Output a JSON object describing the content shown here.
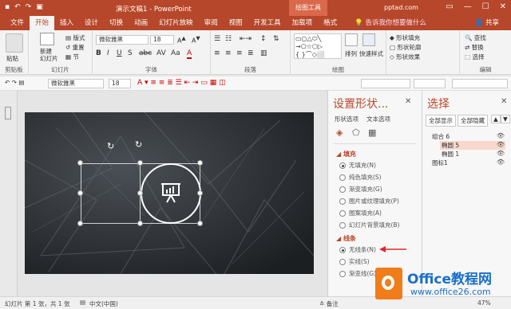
{
  "titlebar": {
    "title": "演示文稿1 - PowerPoint",
    "tool_context": "绘图工具",
    "user": "pptad.com"
  },
  "tabs": {
    "file": "文件",
    "home": "开始",
    "insert": "插入",
    "design": "设计",
    "transitions": "切换",
    "animations": "动画",
    "slideshow": "幻灯片放映",
    "review": "审阅",
    "view": "视图",
    "developer": "开发工具",
    "addins": "加载项",
    "format": "格式",
    "tellme": "告诉我你想要做什么",
    "share": "共享"
  },
  "ribbon": {
    "paste": "粘贴",
    "new_slide": "新建\n幻灯片",
    "layout": "版式",
    "reset": "重置",
    "section": "节",
    "font_name": "微软雅黑",
    "font_size": "18",
    "arrange": "排列",
    "quick_styles": "快速样式",
    "shape_fill": "形状填充",
    "shape_outline": "形状轮廓",
    "shape_effects": "形状效果",
    "find": "查找",
    "replace": "替换",
    "select": "选择",
    "groups": {
      "clipboard": "剪贴板",
      "slides": "幻灯片",
      "font": "字体",
      "paragraph": "段落",
      "drawing": "绘图",
      "editing": "编辑"
    }
  },
  "mini_toolbar": {
    "font_name": "微软雅黑",
    "font_size": "18"
  },
  "format_pane": {
    "title": "设置形状...",
    "tab_shape": "形状选项",
    "tab_text": "文本选项",
    "fill_section": "填充",
    "fill_options": [
      "无填充(N)",
      "纯色填充(S)",
      "渐变填充(G)",
      "图片或纹理填充(P)",
      "图案填充(A)",
      "幻灯片背景填充(B)"
    ],
    "fill_selected": 0,
    "line_section": "线条",
    "line_options": [
      "无线条(N)",
      "实线(S)",
      "渐变线(G)"
    ],
    "line_selected": 0
  },
  "selection_pane": {
    "title": "选择",
    "show_all": "全部显示",
    "hide_all": "全部隐藏",
    "items": [
      {
        "label": "组合 6",
        "level": 0,
        "selected": false
      },
      {
        "label": "椭圆 5",
        "level": 1,
        "selected": true
      },
      {
        "label": "椭圆 1",
        "level": 1,
        "selected": false
      },
      {
        "label": "图标1",
        "level": 0,
        "selected": false
      }
    ]
  },
  "statusbar": {
    "slide_info": "幻灯片 第 1 张，共 1 张",
    "language": "中文(中国)",
    "notes": "备注",
    "zoom": "47%"
  },
  "watermark": {
    "brand": "Office教程网",
    "url": "www.office26.com"
  },
  "colors": {
    "accent": "#b7472a",
    "slide_bg": "#2a2d31",
    "arrow": "#e0282e",
    "watermark_orange": "#f07c1a"
  }
}
